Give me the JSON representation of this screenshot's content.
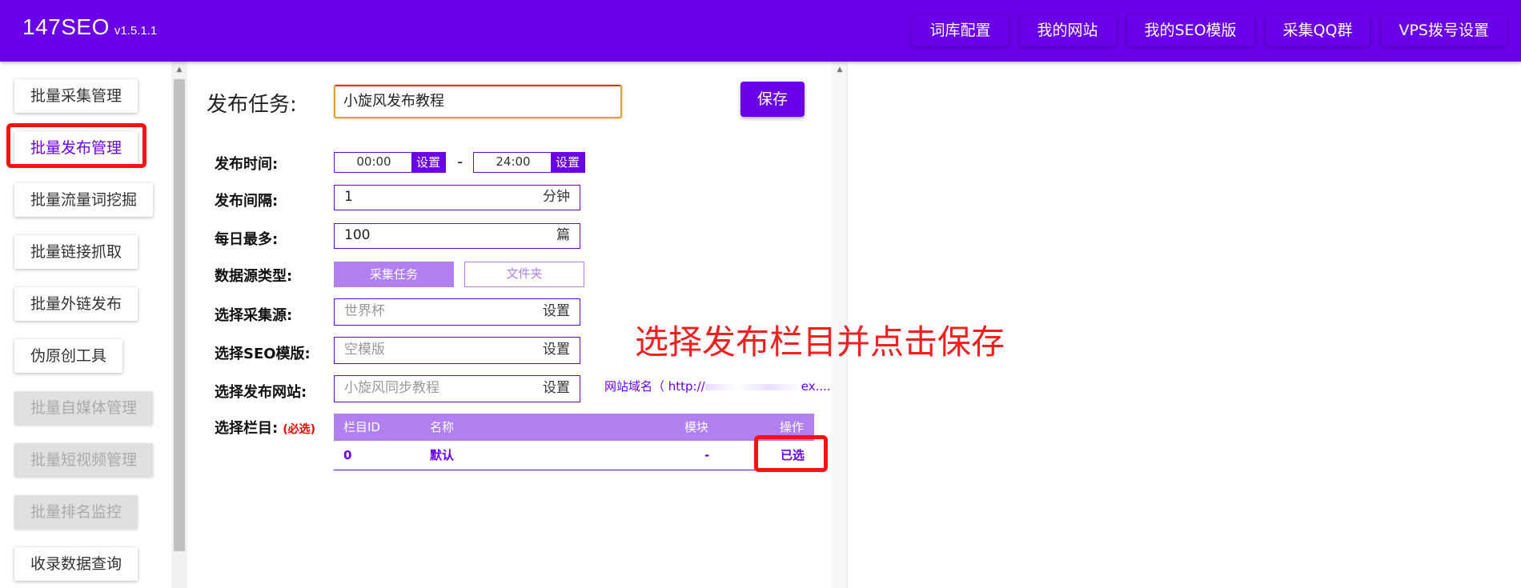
{
  "header": {
    "brand_name": "147SEO",
    "version": "v1.5.1.1",
    "nav": [
      "词库配置",
      "我的网站",
      "我的SEO模版",
      "采集QQ群",
      "VPS拨号设置"
    ]
  },
  "sidebar": {
    "items": [
      {
        "label": "批量采集管理",
        "state": "normal"
      },
      {
        "label": "批量发布管理",
        "state": "active"
      },
      {
        "label": "批量流量词挖掘",
        "state": "normal"
      },
      {
        "label": "批量链接抓取",
        "state": "normal"
      },
      {
        "label": "批量外链发布",
        "state": "normal"
      },
      {
        "label": "伪原创工具",
        "state": "normal"
      },
      {
        "label": "批量自媒体管理",
        "state": "disabled"
      },
      {
        "label": "批量短视频管理",
        "state": "disabled"
      },
      {
        "label": "批量排名监控",
        "state": "disabled"
      },
      {
        "label": "收录数据查询",
        "state": "normal"
      }
    ]
  },
  "form": {
    "title": "发布任务:",
    "task_name": "小旋风发布教程",
    "save_label": "保存",
    "publish_time_label": "发布时间:",
    "start_time": "00:00",
    "end_time": "24:00",
    "set_label": "设置",
    "dash": "-",
    "interval_label": "发布间隔:",
    "interval_value": "1",
    "interval_unit": "分钟",
    "daily_max_label": "每日最多:",
    "daily_max_value": "100",
    "daily_max_unit": "篇",
    "source_type_label": "数据源类型:",
    "source_type_options": [
      "采集任务",
      "文件夹"
    ],
    "source_type_selected": "采集任务",
    "collect_source_label": "选择采集源:",
    "collect_source_value": "世界杯",
    "seo_template_label": "选择SEO模版:",
    "seo_template_value": "空模版",
    "site_label": "选择发布网站:",
    "site_value": "小旋风同步教程",
    "site_domain_prefix": "网站域名（ http://",
    "site_domain_suffix": "ex....",
    "column_label": "选择栏目:",
    "column_required": "(必选)"
  },
  "columns_table": {
    "headers": [
      "栏目ID",
      "名称",
      "模块",
      "操作"
    ],
    "rows": [
      {
        "id": "0",
        "name": "默认",
        "module": "-",
        "action": "已选"
      }
    ]
  },
  "annotation": "选择发布栏目并点击保存",
  "colors": {
    "brand": "#6a00e8",
    "brand_light": "#b07ff0",
    "highlight": "#ff1010"
  }
}
